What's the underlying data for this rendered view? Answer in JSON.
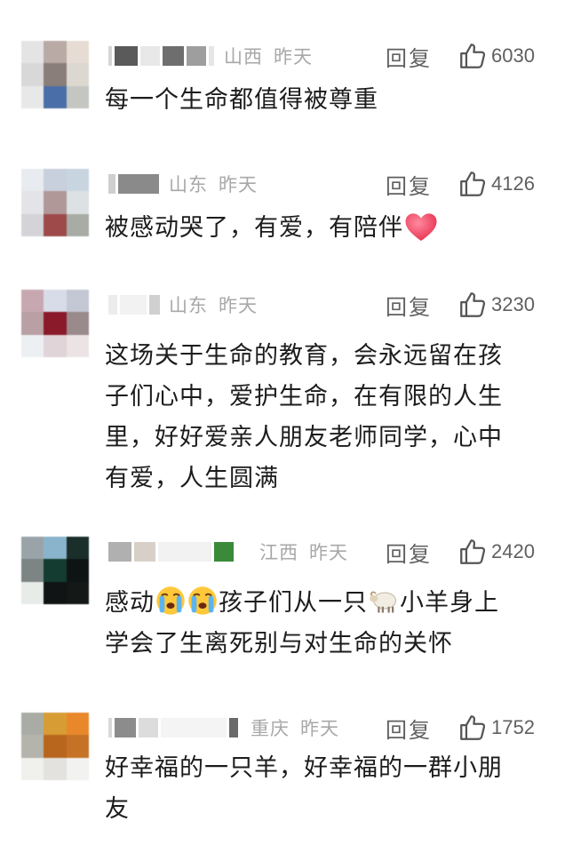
{
  "reply_label": "回复",
  "comments": [
    {
      "region": "山西",
      "time": "昨天",
      "likes": "6030",
      "text": "每一个生命都值得被尊重"
    },
    {
      "region": "山东",
      "time": "昨天",
      "likes": "4126",
      "text": "被感动哭了，有爱，有陪伴",
      "emoji_after": "heart-emoji"
    },
    {
      "region": "山东",
      "time": "昨天",
      "likes": "3230",
      "lines": [
        "这场关于生命的教育，会永远留在孩",
        "子们心中，爱护生命，在有限的人生",
        "里，好好爱亲人朋友老师同学，心中",
        "有爱，人生圆满"
      ]
    },
    {
      "region": "江西",
      "time": "昨天",
      "likes": "2420",
      "line1_a": "感动",
      "line1_b": "孩子们从一只",
      "line1_c": "小羊身上",
      "line2": "学会了生离死别与对生命的关怀",
      "emojis": [
        "crying-face-emoji",
        "crying-face-emoji",
        "sheep-emoji"
      ]
    },
    {
      "region": "重庆",
      "time": "昨天",
      "likes": "1752",
      "lines": [
        "好幸福的一只羊，好幸福的一群小朋",
        "友"
      ]
    }
  ],
  "colors": {
    "meta_gray": "#a8a8a8",
    "action_gray": "#606060",
    "text": "#1c1c1c",
    "heart": "#f0405a"
  }
}
